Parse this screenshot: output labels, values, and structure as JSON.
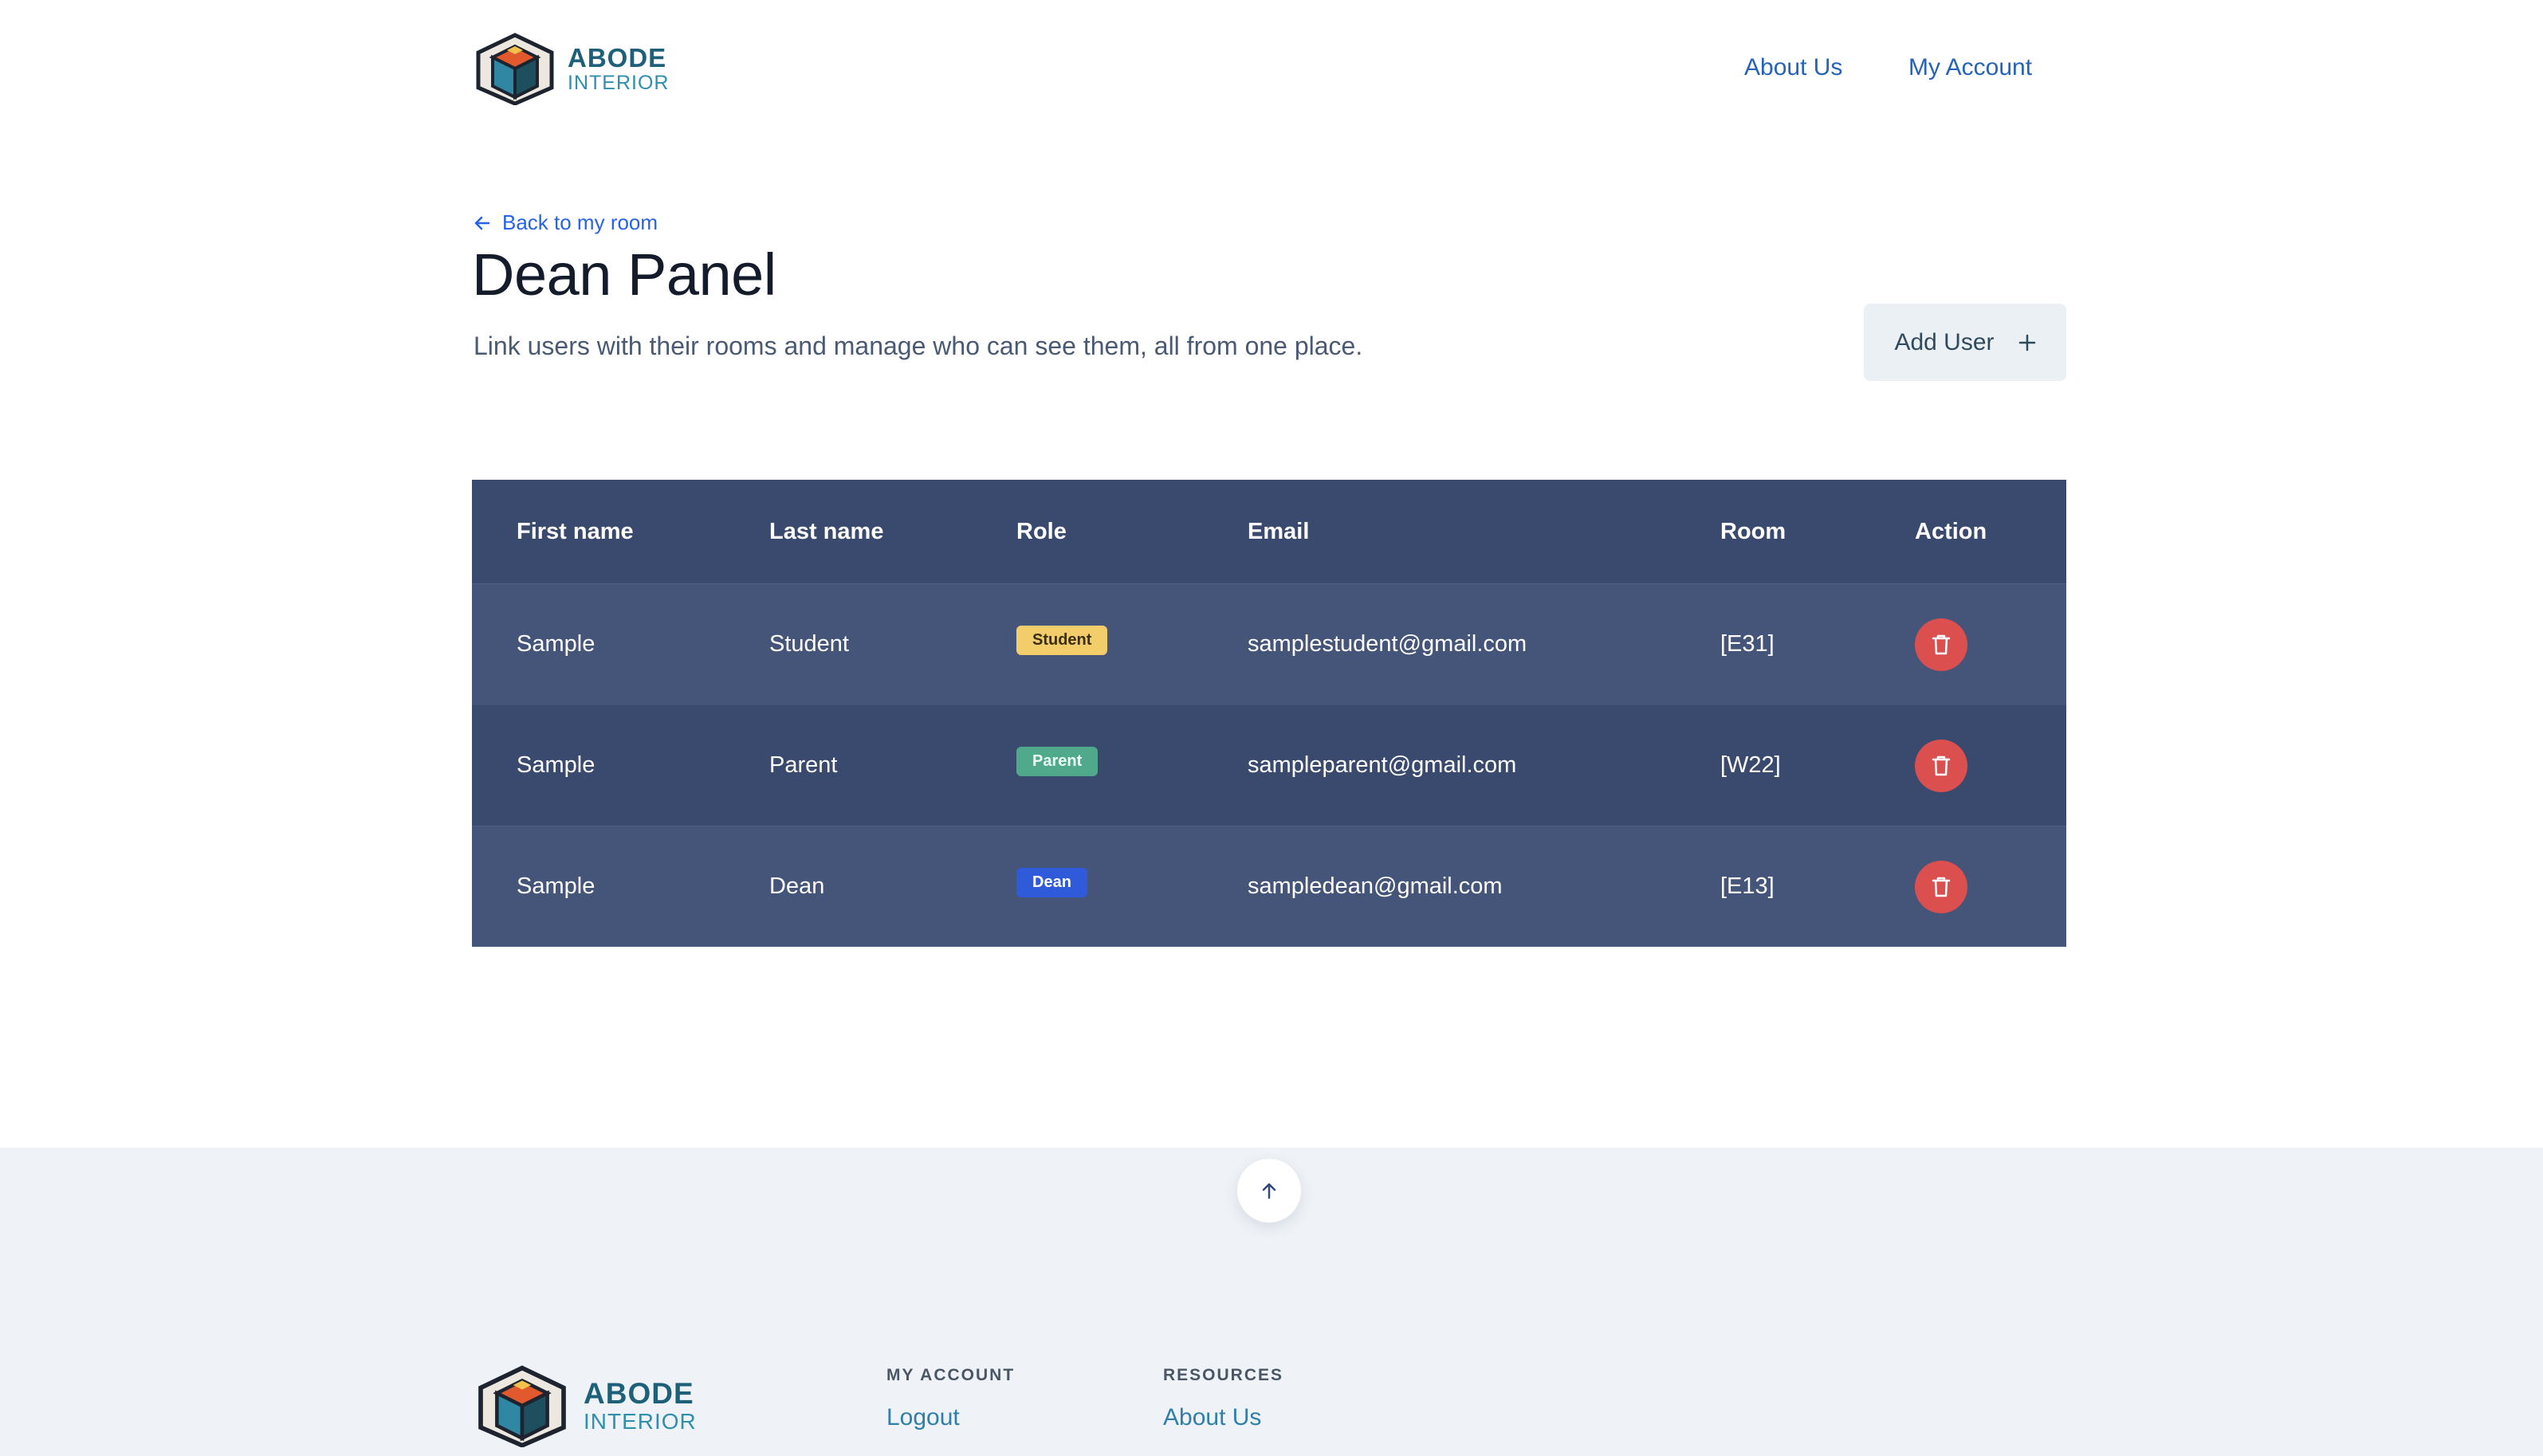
{
  "header": {
    "logo": {
      "line1": "ABODE",
      "line2": "INTERIOR"
    },
    "nav": [
      "About Us",
      "My Account"
    ]
  },
  "page": {
    "back_label": "Back to my room",
    "title": "Dean Panel",
    "subtitle": "Link users with their rooms and manage who can see them, all from one place.",
    "add_button": "Add User"
  },
  "table": {
    "columns": [
      "First name",
      "Last name",
      "Role",
      "Email",
      "Room",
      "Action"
    ],
    "rows": [
      {
        "first": "Sample",
        "last": "Student",
        "role": "Student",
        "email": "samplestudent@gmail.com",
        "room": "[E31]"
      },
      {
        "first": "Sample",
        "last": "Parent",
        "role": "Parent",
        "email": "sampleparent@gmail.com",
        "room": "[W22]"
      },
      {
        "first": "Sample",
        "last": "Dean",
        "role": "Dean",
        "email": "sampledean@gmail.com",
        "room": "[E13]"
      }
    ]
  },
  "footer": {
    "logo": {
      "line1": "ABODE",
      "line2": "INTERIOR"
    },
    "sections": [
      {
        "heading": "MY ACCOUNT",
        "links": [
          "Logout"
        ]
      },
      {
        "heading": "RESOURCES",
        "links": [
          "About Us"
        ]
      }
    ]
  },
  "colors": {
    "table_bg": "#3a4a6e",
    "table_row_alt": "#45557a",
    "student_badge": "#f4cd6b",
    "parent_badge": "#4fa98a",
    "dean_badge": "#2f5bdb",
    "delete": "#dc4f4f",
    "link": "#2563b8"
  },
  "icons": {
    "back": "arrow-left-icon",
    "add": "plus-icon",
    "delete": "trash-icon",
    "scroll_top": "arrow-up-icon"
  }
}
